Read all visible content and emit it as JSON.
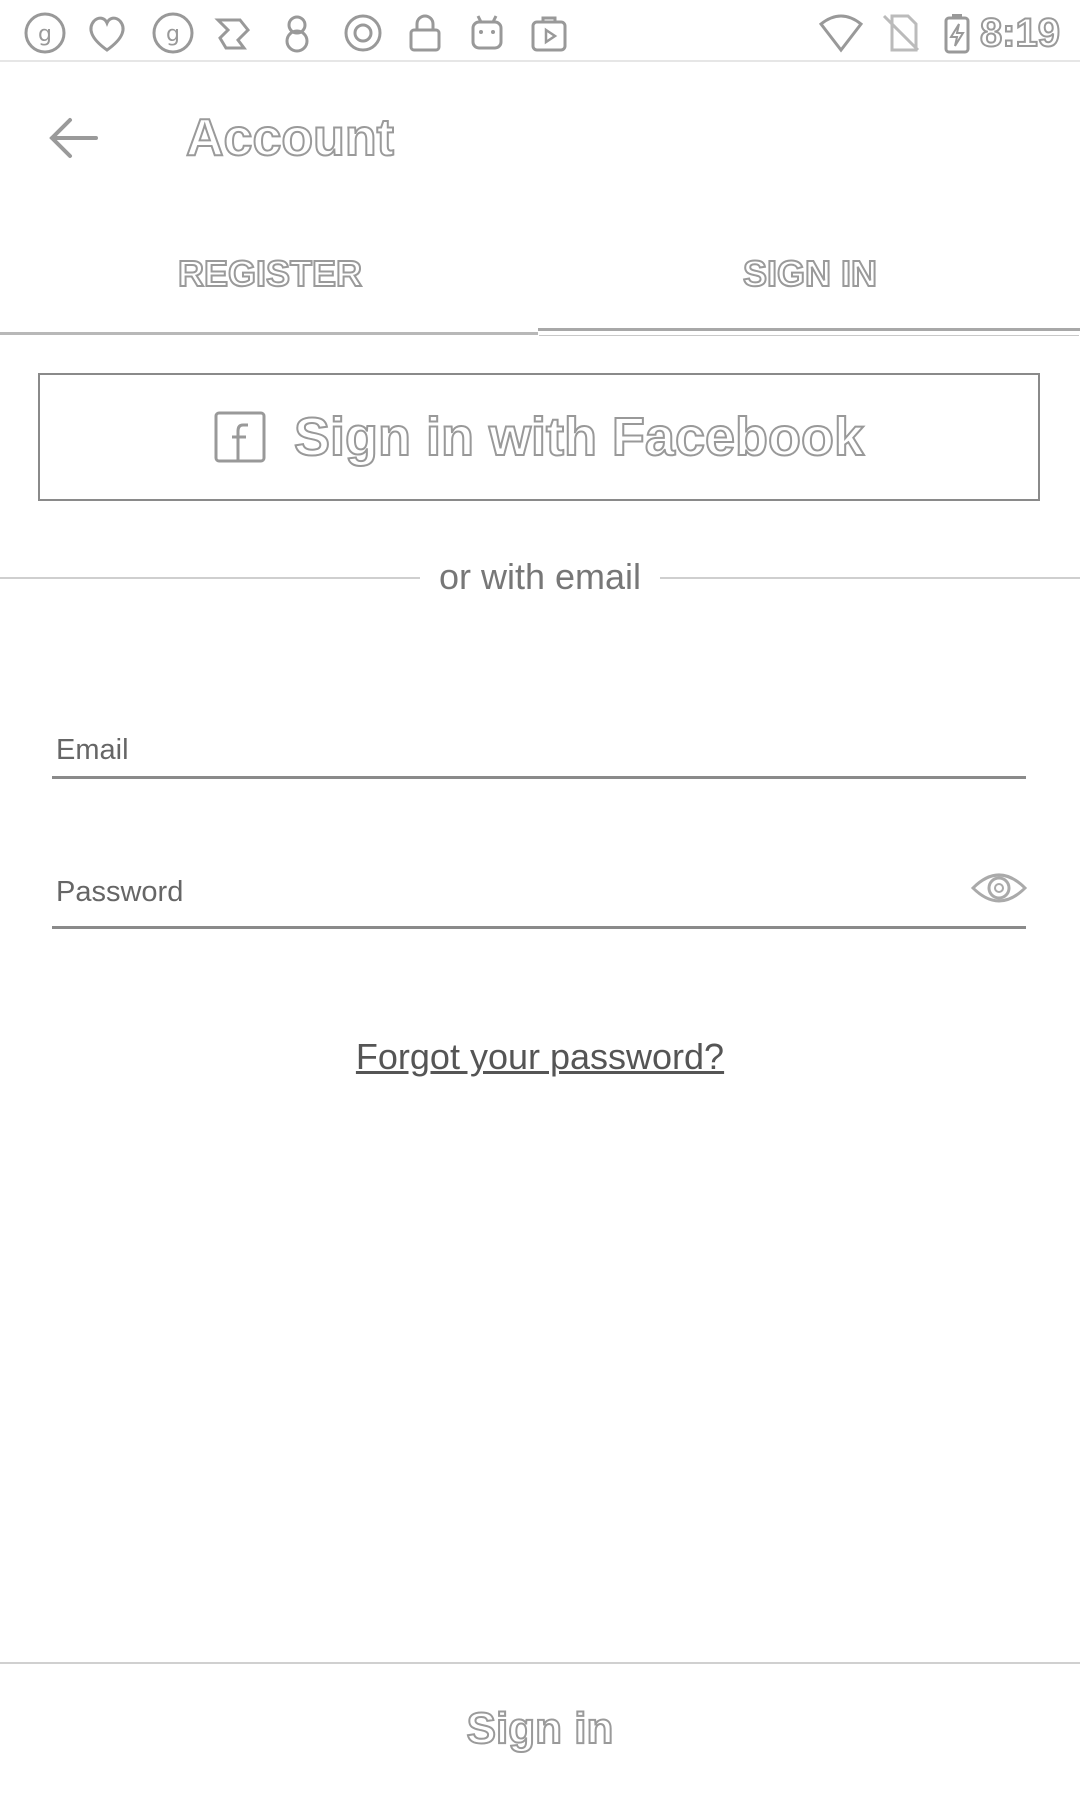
{
  "status_bar": {
    "left_icons": [
      "g-icon",
      "heart-icon",
      "g-icon",
      "puzzle-icon",
      "eight-icon",
      "circle-icon",
      "lock-icon",
      "android-icon",
      "play-store-icon"
    ],
    "right_icons": [
      "wifi-icon",
      "no-sim-icon",
      "battery-charging-icon"
    ],
    "time": "8:19"
  },
  "toolbar": {
    "title": "Account"
  },
  "tabs": [
    {
      "label": "REGISTER",
      "selected": false
    },
    {
      "label": "SIGN IN",
      "selected": true
    }
  ],
  "facebook_button": {
    "label": "Sign in with Facebook"
  },
  "divider": {
    "text": "or with email"
  },
  "email": {
    "label": "Email",
    "value": ""
  },
  "password": {
    "label": "Password",
    "value": ""
  },
  "forgot_link": "Forgot your password?",
  "submit": {
    "label": "Sign in"
  }
}
